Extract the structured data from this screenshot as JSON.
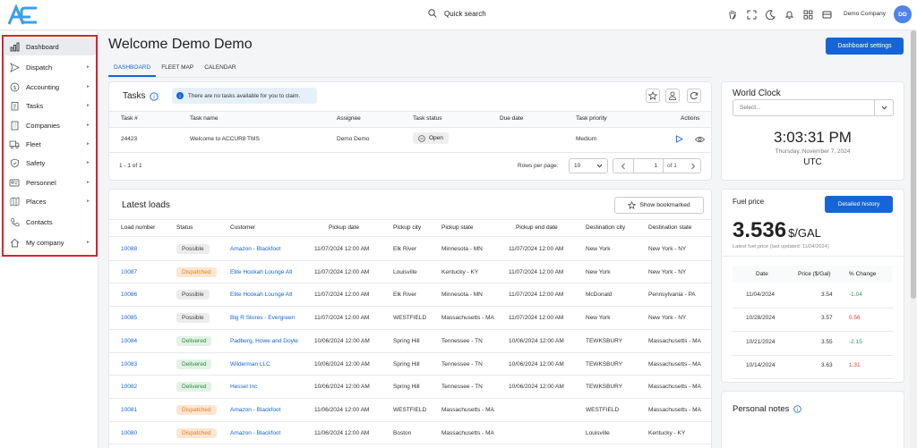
{
  "topbar": {
    "search_label": "Quick search",
    "company": "Demo Company",
    "avatar": "DD"
  },
  "sidebar": {
    "items": [
      {
        "label": "Dashboard",
        "icon": "bar-chart-icon",
        "arrow": false
      },
      {
        "label": "Dispatch",
        "icon": "send-icon",
        "arrow": true
      },
      {
        "label": "Accounting",
        "icon": "dollar-icon",
        "arrow": true
      },
      {
        "label": "Tasks",
        "icon": "clipboard-icon",
        "arrow": true
      },
      {
        "label": "Companies",
        "icon": "building-icon",
        "arrow": true
      },
      {
        "label": "Fleet",
        "icon": "truck-icon",
        "arrow": true
      },
      {
        "label": "Safety",
        "icon": "shield-icon",
        "arrow": true
      },
      {
        "label": "Personnel",
        "icon": "id-card-icon",
        "arrow": true
      },
      {
        "label": "Places",
        "icon": "map-icon",
        "arrow": true
      },
      {
        "label": "Contacts",
        "icon": "phone-icon",
        "arrow": false
      },
      {
        "label": "My company",
        "icon": "home-icon",
        "arrow": true
      }
    ]
  },
  "header": {
    "welcome": "Welcome Demo Demo",
    "settings_button": "Dashboard settings",
    "tabs": [
      "DASHBOARD",
      "FLEET MAP",
      "CALENDAR"
    ]
  },
  "tasks": {
    "title": "Tasks",
    "info": "There are no tasks available for you to claim.",
    "columns": [
      "Task #",
      "Task name",
      "Assignee",
      "Task status",
      "Due date",
      "Task priority",
      "Actions"
    ],
    "row": {
      "num": "24423",
      "name": "Welcome to ACCUR8 TMS",
      "assignee": "Demo Demo",
      "status": "Open",
      "due": "",
      "priority": "Medium"
    },
    "range": "1 - 1 of 1",
    "rows_per_page_label": "Rows per page:",
    "rows_per_page": "10",
    "page": "1",
    "of": "of 1"
  },
  "loads": {
    "title": "Latest loads",
    "bookmark_button": "Show bookmarked",
    "columns": [
      "Load number",
      "Status",
      "Customer",
      "Pickup date",
      "Pickup city",
      "Pickup state",
      "Pickup end date",
      "Destination city",
      "Destination state"
    ],
    "rows": [
      [
        "10088",
        "Possible",
        "Amazon - Blackfoot",
        "11/07/2024 12:00 AM",
        "Elk River",
        "Minnesota - MN",
        "11/07/2024 12:00 AM",
        "New York",
        "New York - NY"
      ],
      [
        "10087",
        "Dispatched",
        "Elite Hookah Lounge Atl",
        "11/07/2024 12:00 AM",
        "Louisville",
        "Kentucky - KY",
        "11/07/2024 12:00 AM",
        "New York",
        "New York - NY"
      ],
      [
        "10086",
        "Possible",
        "Elite Hookah Lounge Atl",
        "11/07/2024 12:00 AM",
        "Elk River",
        "Minnesota - MN",
        "11/07/2024 12:00 AM",
        "McDonald",
        "Pennsylvania - PA"
      ],
      [
        "10085",
        "Possible",
        "Big R Stores - Evergreen",
        "11/07/2024 12:00 AM",
        "WESTFIELD",
        "Massachusetts - MA",
        "11/07/2024 12:00 AM",
        "New York",
        "New York - NY"
      ],
      [
        "10084",
        "Delivered",
        "Padberg, Howe and Doyle",
        "10/06/2024 12:00 AM",
        "Spring Hill",
        "Tennessee - TN",
        "10/06/2024 12:00 AM",
        "TEWKSBURY",
        "Massachusetts - MA"
      ],
      [
        "10083",
        "Delivered",
        "Wilderman LLC",
        "10/06/2024 12:00 AM",
        "Spring Hill",
        "Tennessee - TN",
        "10/06/2024 12:00 AM",
        "TEWKSBURY",
        "Massachusetts - MA"
      ],
      [
        "10082",
        "Delivered",
        "Hessel Inc",
        "10/06/2024 12:00 AM",
        "Spring Hill",
        "Tennessee - TN",
        "10/06/2024 12:00 AM",
        "TEWKSBURY",
        "Massachusetts - MA"
      ],
      [
        "10081",
        "Dispatched",
        "Amazon - Blackfoot",
        "11/06/2024 12:00 AM",
        "WESTFIELD",
        "Massachusetts - MA",
        "",
        "WESTFIELD",
        "Massachusetts - MA"
      ],
      [
        "10080",
        "Dispatched",
        "Amazon - Blackfoot",
        "11/06/2024 12:00 AM",
        "Boston",
        "Massachusetts - MA",
        "",
        "Louisville",
        "Kentucky - KY"
      ]
    ]
  },
  "clock": {
    "title": "World Clock",
    "placeholder": "Select...",
    "time": "3:03:31 PM",
    "date": "Thursday, November 7, 2024",
    "tz": "UTC"
  },
  "fuel": {
    "title": "Fuel price",
    "history_button": "Detailed history",
    "price": "3.536",
    "unit": "$/GAL",
    "updated": "Latest fuel price (last updated: 11/04/2024)",
    "columns": [
      "Date",
      "Price ($/Gal)",
      "% Change"
    ],
    "rows": [
      {
        "date": "11/04/2024",
        "price": "3.54",
        "change": "-1.04",
        "dir": "down"
      },
      {
        "date": "10/28/2024",
        "price": "3.57",
        "change": "0.56",
        "dir": "up"
      },
      {
        "date": "10/21/2024",
        "price": "3.55",
        "change": "-2.15",
        "dir": "down"
      },
      {
        "date": "10/14/2024",
        "price": "3.63",
        "change": "1.31",
        "dir": "up"
      }
    ],
    "colors": {
      "down": "#2e9d4f",
      "up": "#e03a3a"
    }
  },
  "notes": {
    "title": "Personal notes"
  }
}
